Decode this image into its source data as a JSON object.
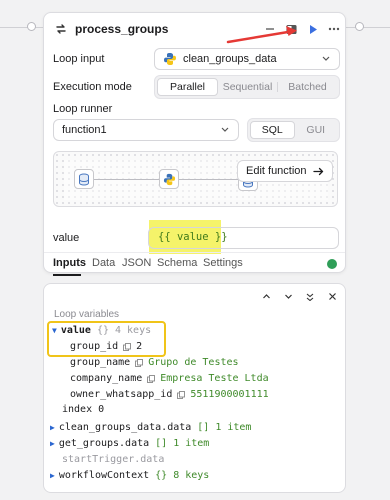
{
  "node": {
    "title": "process_groups",
    "loop_input_label": "Loop input",
    "loop_input_value": "clean_groups_data",
    "execution_mode_label": "Execution mode",
    "execution_modes": [
      "Parallel",
      "Sequential",
      "Batched"
    ],
    "execution_mode_selected": "Parallel",
    "loop_runner_label": "Loop runner",
    "loop_runner_value": "function1",
    "runner_modes": [
      "SQL",
      "GUI"
    ],
    "runner_mode_selected": "SQL",
    "edit_function_label": "Edit function",
    "value_label": "value",
    "value_input": "{{ value }}",
    "tabs": [
      "Inputs",
      "Data",
      "JSON",
      "Schema",
      "Settings"
    ],
    "active_tab": "Inputs"
  },
  "loop_panel": {
    "section_label": "Loop variables",
    "value_key": "value",
    "value_type": "{}",
    "value_count": "4 keys",
    "fields": [
      {
        "key": "group_id",
        "value": "2"
      },
      {
        "key": "group_name",
        "value": "Grupo de Testes"
      },
      {
        "key": "company_name",
        "value": "Empresa Teste Ltda"
      },
      {
        "key": "owner_whatsapp_id",
        "value": "5511900001111"
      }
    ],
    "index_key": "index",
    "index_value": "0",
    "sources": [
      {
        "key": "clean_groups_data.data",
        "type": "[]",
        "count": "1 item"
      },
      {
        "key": "get_groups.data",
        "type": "[]",
        "count": "1 item"
      }
    ],
    "trigger": "startTrigger.data",
    "workflow_key": "workflowContext",
    "workflow_type": "{}",
    "workflow_count": "8 keys"
  },
  "colors": {
    "accent_blue": "#2a66d0",
    "run_blue": "#3b6fe0",
    "annotation_red": "#e53935",
    "highlight_yellow": "#f5f36a",
    "highlight_outline": "#f0c419",
    "success_green": "#2f9e58"
  },
  "icons": {
    "loop": "loop-icon",
    "minimize": "minimize-icon",
    "split": "split-panel-icon",
    "run": "play-icon",
    "more": "more-icon",
    "python": "python-icon",
    "chevron": "chevron-down-icon",
    "arrow": "arrow-right-icon",
    "database": "database-icon"
  }
}
